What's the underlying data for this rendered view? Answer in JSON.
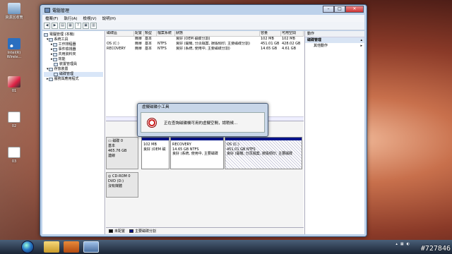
{
  "desktop": {
    "icons": [
      {
        "label": "資源回收筒",
        "icon": "recycle-bin-icon"
      },
      {
        "label": "Intel(R) Wirele...",
        "icon": "wireless-icon"
      },
      {
        "label": "01",
        "icon": "tool-icon"
      },
      {
        "label": "02",
        "icon": "file-icon"
      },
      {
        "label": "03",
        "icon": "file-icon"
      }
    ]
  },
  "window": {
    "title": "電腦管理",
    "menu": [
      "檔案(F)",
      "執行(A)",
      "檢視(V)",
      "說明(H)"
    ],
    "tree": [
      {
        "label": "電腦管理 (本機)",
        "level": 0
      },
      {
        "label": "系統工具",
        "level": 1
      },
      {
        "label": "工作排程器",
        "level": 2
      },
      {
        "label": "事件檢視器",
        "level": 2
      },
      {
        "label": "共用資料夾",
        "level": 2
      },
      {
        "label": "效能",
        "level": 2
      },
      {
        "label": "裝置管理員",
        "level": 2
      },
      {
        "label": "存放裝置",
        "level": 1
      },
      {
        "label": "磁碟管理",
        "level": 2,
        "selected": true
      },
      {
        "label": "服務與應用程式",
        "level": 1
      }
    ],
    "volume_columns": [
      "磁碟區",
      "配置",
      "類型",
      "檔案系統",
      "狀態",
      "容量",
      "可用空間"
    ],
    "volumes": [
      [
        "",
        "簡單",
        "基本",
        "",
        "良好 (OEM 磁碟分割)",
        "102 MB",
        "102 MB"
      ],
      [
        "OS (C:)",
        "簡單",
        "基本",
        "NTFS",
        "良好 (開機, 分頁檔案, 損毀傾印, 主要磁碟分割)",
        "451.01 GB",
        "428.02 GB"
      ],
      [
        "RECOVERY",
        "簡單",
        "基本",
        "NTFS",
        "良好 (系統, 使用中, 主要磁碟分割)",
        "14.65 GB",
        "4.61 GB"
      ]
    ],
    "disks": [
      {
        "name": "磁碟 0",
        "type": "基本",
        "size": "465.76 GB",
        "status": "連線",
        "partitions": [
          {
            "title": "",
            "size": "102 MB",
            "status": "良好 (OEM 磁"
          },
          {
            "title": "RECOVERY",
            "size": "14.65 GB NTFS",
            "status": "良好 (系統, 使用中, 主要磁碟"
          },
          {
            "title": "OS (C:)",
            "size": "451.01 GB NTFS",
            "status": "良好 (開機, 分頁檔案, 損毀傾印, 主要磁碟"
          }
        ]
      },
      {
        "name": "CD-ROM 0",
        "type": "DVD (D:)",
        "size": "",
        "status": "沒有媒體",
        "partitions": []
      }
    ],
    "legend": [
      "未配置",
      "主要磁碟分割"
    ],
    "actions": {
      "header": "動作",
      "section": "磁碟管理",
      "item": "其他動作"
    }
  },
  "dialog": {
    "title": "虛擬磁碟小工具",
    "message": "正在查詢磁碟機可用的虛擬空間，請稍候..."
  },
  "watermark": "#727846",
  "colors": {
    "primary_partition": "#00128a",
    "unallocated": "#000000"
  }
}
